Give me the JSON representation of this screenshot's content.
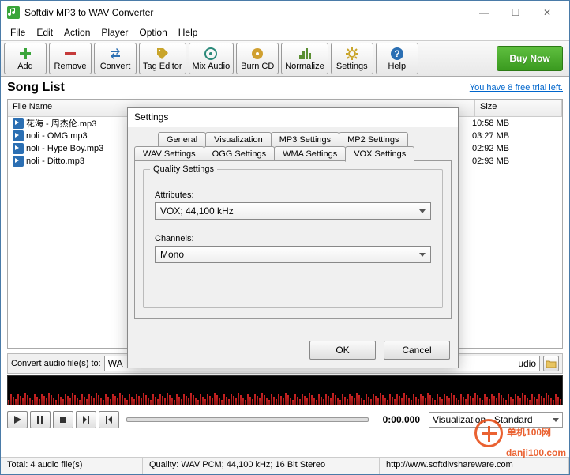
{
  "title": "Softdiv MP3 to WAV Converter",
  "menu": [
    "File",
    "Edit",
    "Action",
    "Player",
    "Option",
    "Help"
  ],
  "toolbar": [
    {
      "name": "add",
      "label": "Add",
      "color": "#3aa53a"
    },
    {
      "name": "remove",
      "label": "Remove",
      "color": "#c53a3a"
    },
    {
      "name": "convert",
      "label": "Convert",
      "color": "#2b6fb3"
    },
    {
      "name": "tag-editor",
      "label": "Tag Editor",
      "color": "#c9a52b"
    },
    {
      "name": "mix-audio",
      "label": "Mix Audio",
      "color": "#2b8a7a"
    },
    {
      "name": "burn-cd",
      "label": "Burn CD",
      "color": "#d0a030"
    },
    {
      "name": "normalize",
      "label": "Normalize",
      "color": "#5b8f33"
    },
    {
      "name": "settings",
      "label": "Settings",
      "color": "#c9a52b"
    },
    {
      "name": "help",
      "label": "Help",
      "color": "#2b6fb3"
    }
  ],
  "buy_now": "Buy Now",
  "songlist_title": "Song List",
  "trial_msg": "You have 8 free trial left.",
  "columns": {
    "name": "File Name",
    "size": "Size"
  },
  "files": [
    {
      "name": "花海 - 周杰伦.mp3",
      "size": "10:58 MB"
    },
    {
      "name": "noli - OMG.mp3",
      "size": "03:27 MB"
    },
    {
      "name": "noli - Hype Boy.mp3",
      "size": "02:92 MB"
    },
    {
      "name": "noli - Ditto.mp3",
      "size": "02:93 MB"
    }
  ],
  "convert_label": "Convert audio file(s) to:",
  "convert_format_visible_left": "WA",
  "convert_format_visible_right": "udio",
  "player_time": "0:00.000",
  "viz_select": "Visualization - Standard",
  "status": {
    "total": "Total: 4 audio file(s)",
    "quality": "Quality: WAV PCM; 44,100 kHz; 16 Bit Stereo",
    "url": "http://www.softdivshareware.com"
  },
  "watermark": {
    "brand": "单机100网",
    "site": "danji100.com"
  },
  "dialog": {
    "title": "Settings",
    "tabs_row1": [
      "General",
      "Visualization",
      "MP3 Settings",
      "MP2 Settings"
    ],
    "tabs_row2": [
      "WAV Settings",
      "OGG Settings",
      "WMA Settings",
      "VOX Settings"
    ],
    "active_tab": "VOX Settings",
    "group": "Quality Settings",
    "attr_label": "Attributes:",
    "attr_value": "VOX; 44,100 kHz",
    "chan_label": "Channels:",
    "chan_value": "Mono",
    "ok": "OK",
    "cancel": "Cancel"
  }
}
